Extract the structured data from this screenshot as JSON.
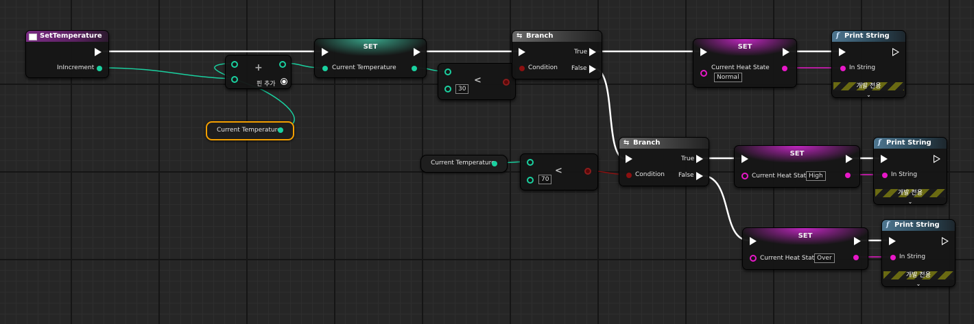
{
  "event_node": {
    "title": "SetTemperature",
    "pin_label": "InIncrement"
  },
  "add_node": {
    "symbol": "+",
    "add_pin_label": "핀 추가"
  },
  "getter_nodes": [
    {
      "label": "Current Temperature"
    },
    {
      "label": "Current Temperature"
    }
  ],
  "set_temperature": {
    "title": "SET",
    "pin_label": "Current Temperature"
  },
  "compare_nodes": [
    {
      "value": "30",
      "operator": "<"
    },
    {
      "value": "70",
      "operator": "<"
    }
  ],
  "branch_nodes": [
    {
      "title": "Branch",
      "true_label": "True",
      "false_label": "False",
      "condition_label": "Condition"
    },
    {
      "title": "Branch",
      "true_label": "True",
      "false_label": "False",
      "condition_label": "Condition"
    }
  ],
  "set_heat_state": [
    {
      "title": "SET",
      "pin_label": "Current Heat State",
      "value": "Normal"
    },
    {
      "title": "SET",
      "pin_label": "Current Heat State",
      "value": "High"
    },
    {
      "title": "SET",
      "pin_label": "Current Heat State",
      "value": "Over"
    }
  ],
  "print_nodes": [
    {
      "title": "Print String",
      "pin_label": "In String",
      "dev_label": "개발 전용",
      "expand": "⌄",
      "icon": "f"
    },
    {
      "title": "Print String",
      "pin_label": "In String",
      "dev_label": "개발 전용",
      "expand": "⌄",
      "icon": "f"
    },
    {
      "title": "Print String",
      "pin_label": "In String",
      "dev_label": "개발 전용",
      "expand": "⌄",
      "icon": "f"
    }
  ],
  "colors": {
    "float_pin": "#1ad1a0",
    "enum_pin": "#e818c8",
    "bool_pin": "#8c1010",
    "exec_wire": "#ffffff",
    "selection": "#f5a000"
  }
}
